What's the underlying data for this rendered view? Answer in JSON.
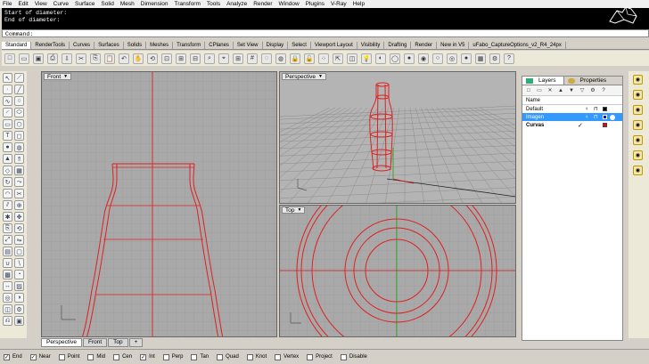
{
  "menu": [
    "File",
    "Edit",
    "View",
    "Curve",
    "Surface",
    "Solid",
    "Mesh",
    "Dimension",
    "Transform",
    "Tools",
    "Analyze",
    "Render",
    "Window",
    "Plugins",
    "V-Ray",
    "Help"
  ],
  "command": {
    "history": [
      "Start of diameter:",
      "End of diameter:"
    ],
    "prompt": "Command:"
  },
  "toolbar_tabs": [
    "Standard",
    "RenderTools",
    "Curves",
    "Surfaces",
    "Solids",
    "Meshes",
    "Transform",
    "CPlanes",
    "Set View",
    "Display",
    "Select",
    "Viewport Layout",
    "Visibility",
    "Drafting",
    "Render",
    "New in V5",
    "uFabo_CaptureOptions_v2_R4_24px"
  ],
  "viewports": {
    "front": {
      "label": "Front"
    },
    "perspective": {
      "label": "Perspective"
    },
    "top": {
      "label": "Top"
    }
  },
  "viewport_tabs": [
    "Perspective",
    "Front",
    "Top"
  ],
  "panel": {
    "tabs": [
      "Layers",
      "Properties"
    ],
    "header": "Name",
    "layers": [
      {
        "name": "Default",
        "color": "#000000"
      },
      {
        "name": "Imagen",
        "color": "#0000ff"
      },
      {
        "name": "Curvas",
        "color": "#ff0000"
      }
    ]
  },
  "snaps": [
    {
      "label": "End",
      "checked": true
    },
    {
      "label": "Near",
      "checked": true
    },
    {
      "label": "Point",
      "checked": false
    },
    {
      "label": "Mid",
      "checked": false
    },
    {
      "label": "Cen",
      "checked": false
    },
    {
      "label": "Int",
      "checked": true
    },
    {
      "label": "Perp",
      "checked": false
    },
    {
      "label": "Tan",
      "checked": false
    },
    {
      "label": "Quad",
      "checked": false
    },
    {
      "label": "Knot",
      "checked": false
    },
    {
      "label": "Vertex",
      "checked": false
    },
    {
      "label": "Project",
      "checked": false
    },
    {
      "label": "Disable",
      "checked": false
    }
  ],
  "colors": {
    "curve": "#e02020",
    "grid": "#8a8a8a",
    "viewport_bg": "#a8a8a8",
    "accent": "#3399ff"
  }
}
